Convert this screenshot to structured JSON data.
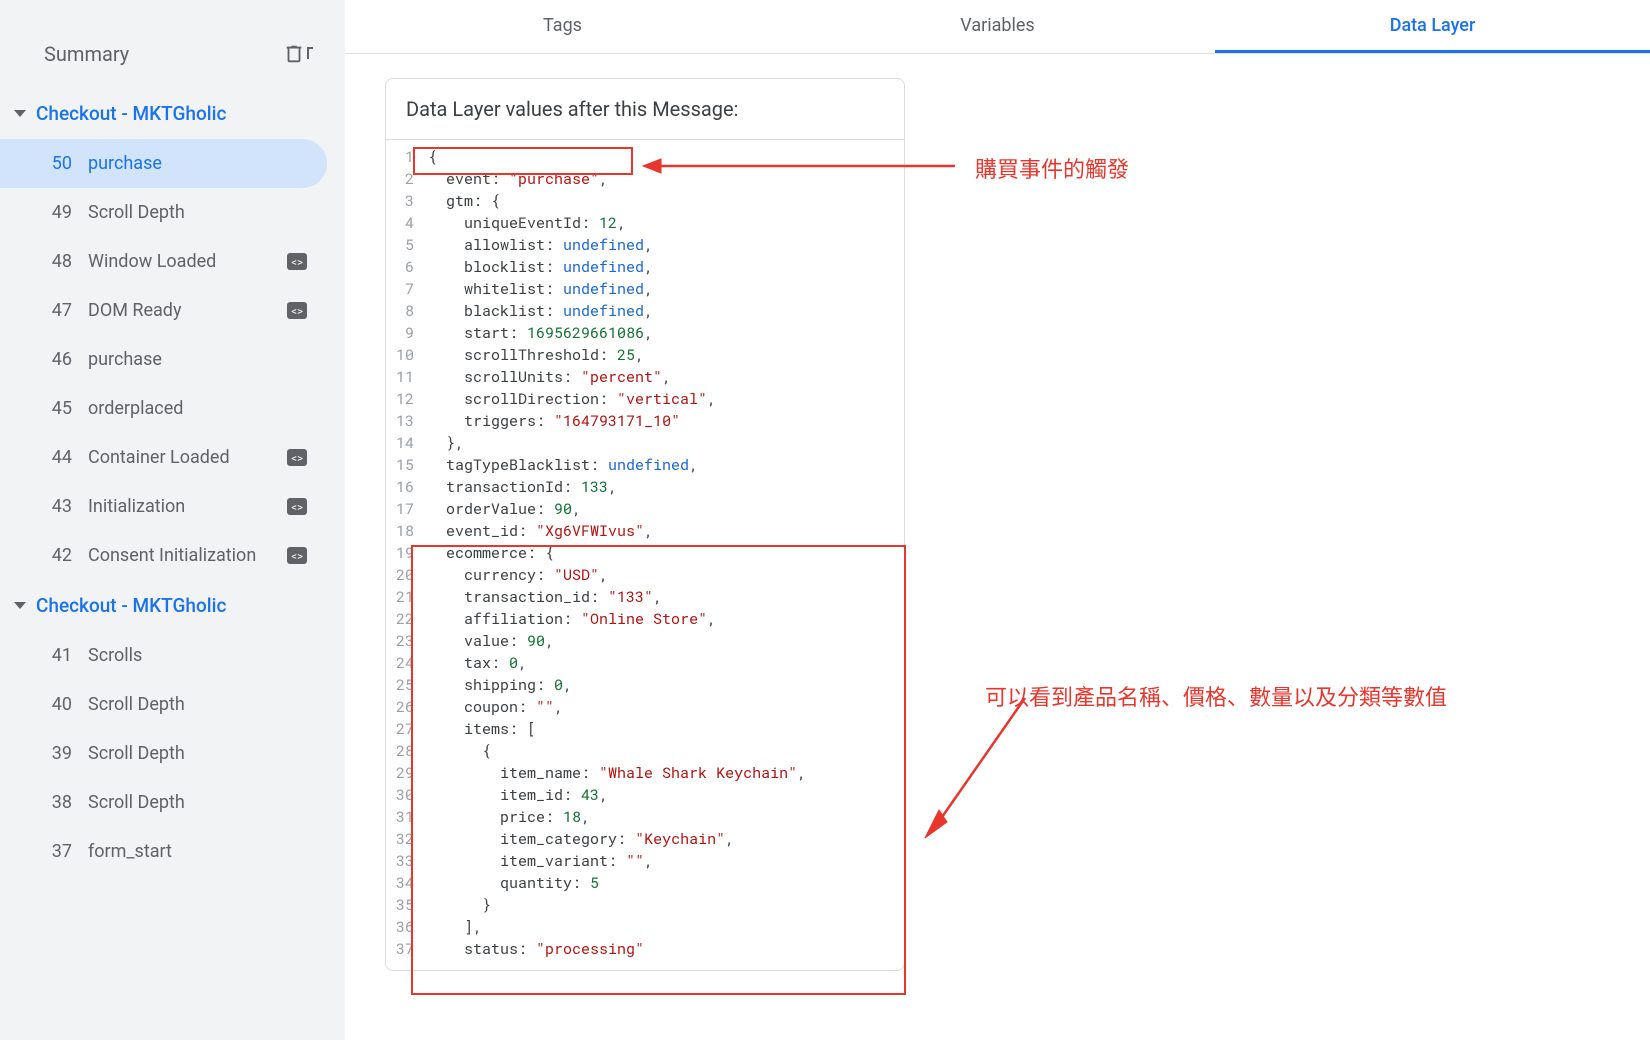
{
  "sidebar": {
    "summary_label": "Summary",
    "groups": [
      {
        "title": "Checkout - MKTGholic",
        "items": [
          {
            "num": "50",
            "label": "purchase",
            "selected": true,
            "badge": false
          },
          {
            "num": "49",
            "label": "Scroll Depth",
            "selected": false,
            "badge": false
          },
          {
            "num": "48",
            "label": "Window Loaded",
            "selected": false,
            "badge": true
          },
          {
            "num": "47",
            "label": "DOM Ready",
            "selected": false,
            "badge": true
          },
          {
            "num": "46",
            "label": "purchase",
            "selected": false,
            "badge": false
          },
          {
            "num": "45",
            "label": "orderplaced",
            "selected": false,
            "badge": false
          },
          {
            "num": "44",
            "label": "Container Loaded",
            "selected": false,
            "badge": true
          },
          {
            "num": "43",
            "label": "Initialization",
            "selected": false,
            "badge": true
          },
          {
            "num": "42",
            "label": "Consent Initialization",
            "selected": false,
            "badge": true
          }
        ]
      },
      {
        "title": "Checkout - MKTGholic",
        "items": [
          {
            "num": "41",
            "label": "Scrolls",
            "selected": false,
            "badge": false
          },
          {
            "num": "40",
            "label": "Scroll Depth",
            "selected": false,
            "badge": false
          },
          {
            "num": "39",
            "label": "Scroll Depth",
            "selected": false,
            "badge": false
          },
          {
            "num": "38",
            "label": "Scroll Depth",
            "selected": false,
            "badge": false
          },
          {
            "num": "37",
            "label": "form_start",
            "selected": false,
            "badge": false
          }
        ]
      }
    ]
  },
  "tabs": {
    "tags": "Tags",
    "variables": "Variables",
    "datalayer": "Data Layer"
  },
  "panel": {
    "title": "Data Layer values after this Message:"
  },
  "datalayer": {
    "event": "purchase",
    "gtm": {
      "uniqueEventId": 12,
      "allowlist": "undefined",
      "blocklist": "undefined",
      "whitelist": "undefined",
      "blacklist": "undefined",
      "start": 1695629661086,
      "scrollThreshold": 25,
      "scrollUnits": "percent",
      "scrollDirection": "vertical",
      "triggers": "164793171_10"
    },
    "tagTypeBlacklist": "undefined",
    "transactionId": 133,
    "orderValue": 90,
    "event_id": "Xg6VFWIvus",
    "ecommerce": {
      "currency": "USD",
      "transaction_id": "133",
      "affiliation": "Online Store",
      "value": 90,
      "tax": 0,
      "shipping": 0,
      "coupon": "",
      "items": [
        {
          "item_name": "Whale Shark Keychain",
          "item_id": 43,
          "price": 18,
          "item_category": "Keychain",
          "item_variant": "",
          "quantity": 5
        }
      ],
      "status": "processing"
    }
  },
  "annotations": {
    "a1": "購買事件的觸發",
    "a2": "可以看到產品名稱、價格、數量以及分類等數值"
  }
}
